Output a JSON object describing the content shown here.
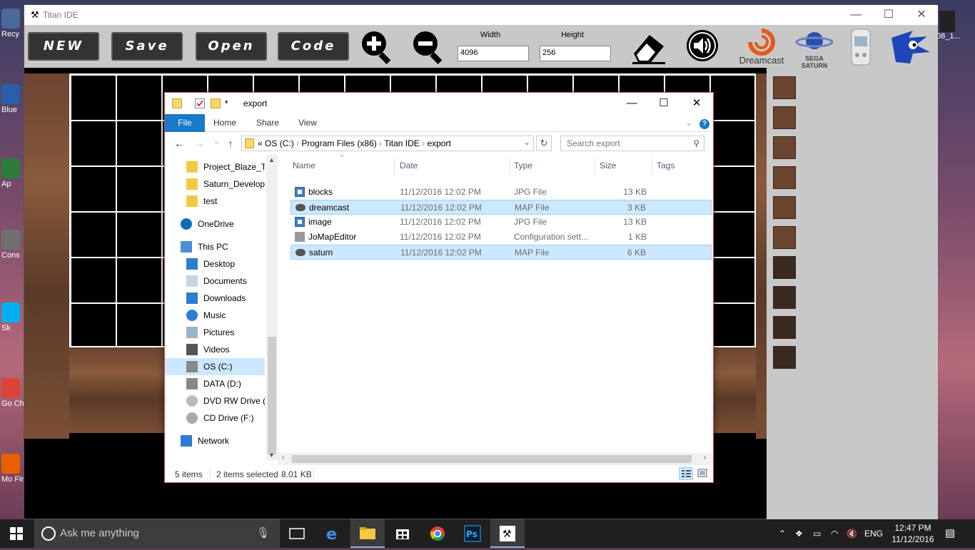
{
  "desktop": {
    "icons": [
      {
        "label": "Recy",
        "color": "#4a6a9a"
      },
      {
        "label": "Blue",
        "color": "#2a5ea8"
      },
      {
        "label": "Ap",
        "color": "#2d7d3a"
      },
      {
        "label": "Cons",
        "color": "#707070"
      },
      {
        "label": "Sk",
        "color": "#00aff0"
      },
      {
        "label": "Go Chr",
        "color": "#db4437"
      },
      {
        "label": "Mo Fir",
        "color": "#e66000"
      }
    ],
    "right_icon_label": "08_1..."
  },
  "titan": {
    "title": "Titan IDE",
    "buttons": {
      "new": "NEW",
      "save": "Save",
      "open": "Open",
      "code": "Code"
    },
    "width_label": "Width",
    "height_label": "Height",
    "width_value": "4096",
    "height_value": "256",
    "dreamcast_label": "Dreamcast",
    "saturn_label": "SEGA SATURN"
  },
  "explorer": {
    "title": "export",
    "tabs": {
      "file": "File",
      "home": "Home",
      "share": "Share",
      "view": "View"
    },
    "breadcrumb": [
      "«",
      "OS (C:)",
      "Program Files (x86)",
      "Titan IDE",
      "export"
    ],
    "search_placeholder": "Search export",
    "nav": [
      {
        "label": "Project_Blaze_Tra",
        "icon": "folder"
      },
      {
        "label": "Saturn_Developn",
        "icon": "folder"
      },
      {
        "label": "test",
        "icon": "folder"
      },
      {
        "label": "OneDrive",
        "icon": "cloud"
      },
      {
        "label": "This PC",
        "icon": "pc"
      },
      {
        "label": "Desktop",
        "icon": "desktop"
      },
      {
        "label": "Documents",
        "icon": "docs"
      },
      {
        "label": "Downloads",
        "icon": "download"
      },
      {
        "label": "Music",
        "icon": "music"
      },
      {
        "label": "Pictures",
        "icon": "pictures"
      },
      {
        "label": "Videos",
        "icon": "videos"
      },
      {
        "label": "OS (C:)",
        "icon": "drive"
      },
      {
        "label": "DATA (D:)",
        "icon": "drive"
      },
      {
        "label": "DVD RW Drive (E",
        "icon": "dvd"
      },
      {
        "label": "CD Drive (F:)",
        "icon": "cd"
      },
      {
        "label": "Network",
        "icon": "network"
      }
    ],
    "columns": {
      "name": "Name",
      "date": "Date",
      "type": "Type",
      "size": "Size",
      "tags": "Tags"
    },
    "files": [
      {
        "name": "blocks",
        "date": "11/12/2016 12:02 PM",
        "type": "JPG File",
        "size": "13 KB",
        "selected": false,
        "icon": "jpg"
      },
      {
        "name": "dreamcast",
        "date": "11/12/2016 12:02 PM",
        "type": "MAP File",
        "size": "3 KB",
        "selected": true,
        "icon": "map"
      },
      {
        "name": "image",
        "date": "11/12/2016 12:02 PM",
        "type": "JPG File",
        "size": "13 KB",
        "selected": false,
        "icon": "jpg"
      },
      {
        "name": "JoMapEditor",
        "date": "11/12/2016 12:02 PM",
        "type": "Configuration sett...",
        "size": "1 KB",
        "selected": false,
        "icon": "cfg"
      },
      {
        "name": "saturn",
        "date": "11/12/2016 12:02 PM",
        "type": "MAP File",
        "size": "6 KB",
        "selected": true,
        "icon": "map"
      }
    ],
    "status": {
      "items": "5 items",
      "selected": "2 items selected",
      "size": "8.01 KB"
    }
  },
  "taskbar": {
    "search_placeholder": "Ask me anything",
    "lang": "ENG",
    "time": "12:47 PM",
    "date": "11/12/2016"
  }
}
